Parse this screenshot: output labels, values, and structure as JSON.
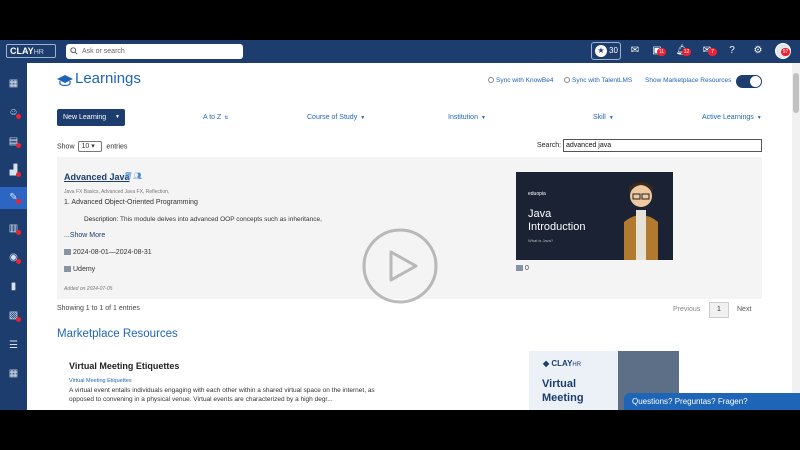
{
  "header": {
    "logo_text": "CLAY",
    "logo_suffix": "HR",
    "search_placeholder": "Ask or search",
    "stars_count": "30",
    "badges": {
      "briefcase": "11",
      "bell": "12",
      "mail": "7",
      "avatar": "97"
    }
  },
  "page": {
    "title": "Learnings",
    "sync_knowbe4": "Sync with KnowBe4",
    "sync_talentlms": "Sync with TalentLMS",
    "show_marketplace": "Show Marketplace Resources",
    "marketplace_toggle_on": true
  },
  "toolbar": {
    "new_learning": "New Learning",
    "filters": [
      "A to Z",
      "Course of Study",
      "Institution",
      "Skill",
      "Active Learnings"
    ]
  },
  "table_controls": {
    "show_label": "Show",
    "page_size": "10",
    "entries_label": "entries",
    "search_label": "Search:",
    "search_value": "advanced java"
  },
  "learning": {
    "title": "Advanced Java",
    "tags": "Java FX Basics, Advanced Java FX, Reflection,",
    "module": "1. Advanced Object-Oriented Programming",
    "description_label": "Description:",
    "description": "This module delves into advanced OOP concepts such as inheritance,",
    "show_more": "...Show More",
    "dates": "2024-08-01—2024-08-31",
    "institution": "Udemy",
    "added": "Added on 2024-07-05",
    "views": "0",
    "thumbnail": {
      "brand": "eduopia",
      "title_line1": "Java",
      "title_line2": "Introduction",
      "subtitle": "What is Java?"
    }
  },
  "pagination": {
    "info": "Showing 1 to 1 of 1 entries",
    "previous": "Previous",
    "current_page": "1",
    "next": "Next"
  },
  "marketplace": {
    "section_title": "Marketplace Resources",
    "item": {
      "title": "Virtual Meeting Etiquettes",
      "tag": "Virtual Meeting Etiquettes",
      "description": "A virtual event entails individuals engaging with each other within a shared virtual space on the internet, as opposed to convening in a physical venue. Virtual events are characterized by a high degr...",
      "thumb_logo": "CLAY",
      "thumb_logo_suffix": "HR",
      "thumb_title": "Virtual Meeting"
    }
  },
  "chat": {
    "label": "Questions? Preguntas? Fragen?"
  },
  "colors": {
    "navy": "#1c3d6e",
    "accent_blue": "#1e65b8",
    "badge_red": "#ee2233"
  }
}
